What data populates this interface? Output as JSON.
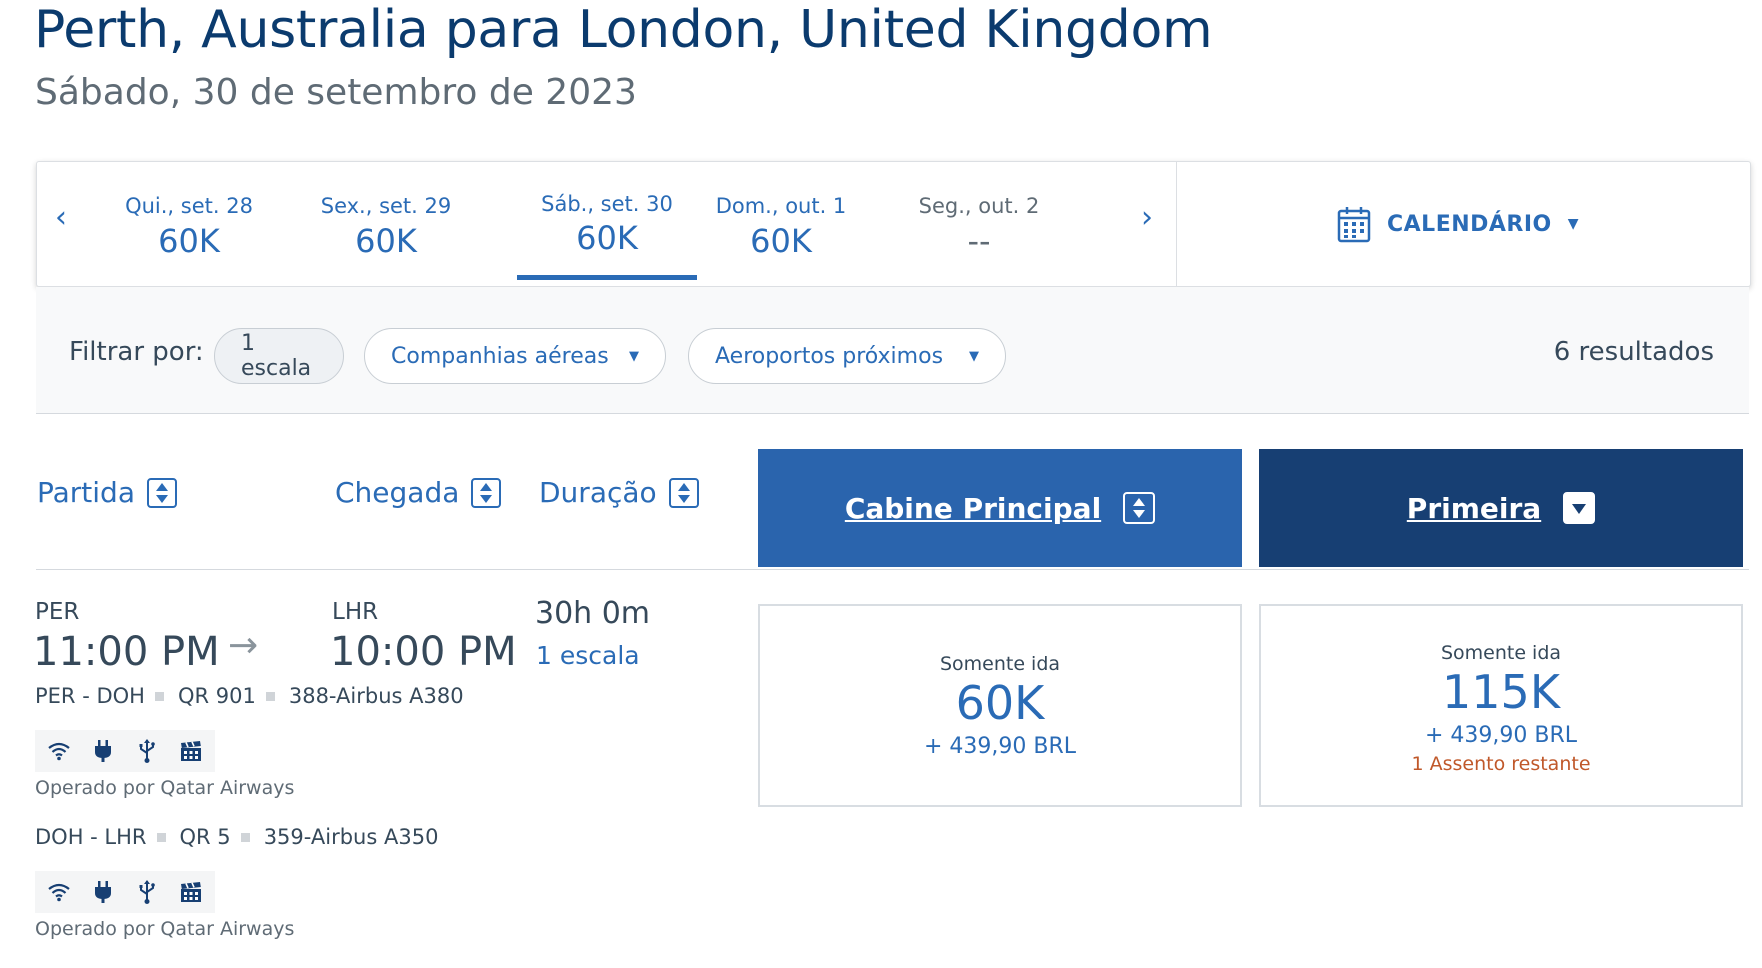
{
  "header": {
    "route": "Perth, Australia para London, United Kingdom",
    "date": "Sábado, 30 de setembro de 2023"
  },
  "date_strip": {
    "prev_glyph": "‹",
    "next_glyph": "›",
    "dates": [
      {
        "label": "Qui., set. 28",
        "price": "60K",
        "selected": false
      },
      {
        "label": "Sex., set. 29",
        "price": "60K",
        "selected": false
      },
      {
        "label": "Sáb., set. 30",
        "price": "60K",
        "selected": true
      },
      {
        "label": "Dom., out. 1",
        "price": "60K",
        "selected": false
      },
      {
        "label": "Seg., out. 2",
        "price": "--",
        "selected": false
      }
    ],
    "calendar_label": "CALENDÁRIO"
  },
  "filters": {
    "label": "Filtrar por:",
    "stops": "1 escala",
    "airlines": "Companhias aéreas",
    "airports": "Aeroportos próximos",
    "results": "6 resultados"
  },
  "columns": {
    "departure": "Partida",
    "arrival": "Chegada",
    "duration": "Duração",
    "main_cabin": "Cabine Principal",
    "first": "Primeira"
  },
  "flight": {
    "origin": "PER",
    "destination": "LHR",
    "depart_time": "11:00 PM",
    "arrive_time": "10:00 PM",
    "duration": "30h 0m",
    "stops": "1 escala",
    "segments": [
      {
        "route": "PER - DOH",
        "flight_no": "QR 901",
        "aircraft": "388-Airbus A380",
        "operator": "Operado por Qatar Airways"
      },
      {
        "route": "DOH - LHR",
        "flight_no": "QR 5",
        "aircraft": "359-Airbus A350",
        "operator": "Operado por Qatar Airways"
      }
    ],
    "amenity_icons": [
      "wifi-icon",
      "power-plug-icon",
      "usb-icon",
      "entertainment-icon"
    ],
    "fares": {
      "main": {
        "kind": "Somente ida",
        "miles": "60K",
        "tax": "+ 439,90 BRL"
      },
      "first": {
        "kind": "Somente ida",
        "miles": "115K",
        "tax": "+ 439,90 BRL",
        "seats": "1 Assento restante"
      }
    }
  },
  "colors": {
    "brand_blue": "#2a64ad",
    "dark_blue": "#173f73",
    "link_blue": "#2a6bb6",
    "warning": "#c0582a"
  }
}
